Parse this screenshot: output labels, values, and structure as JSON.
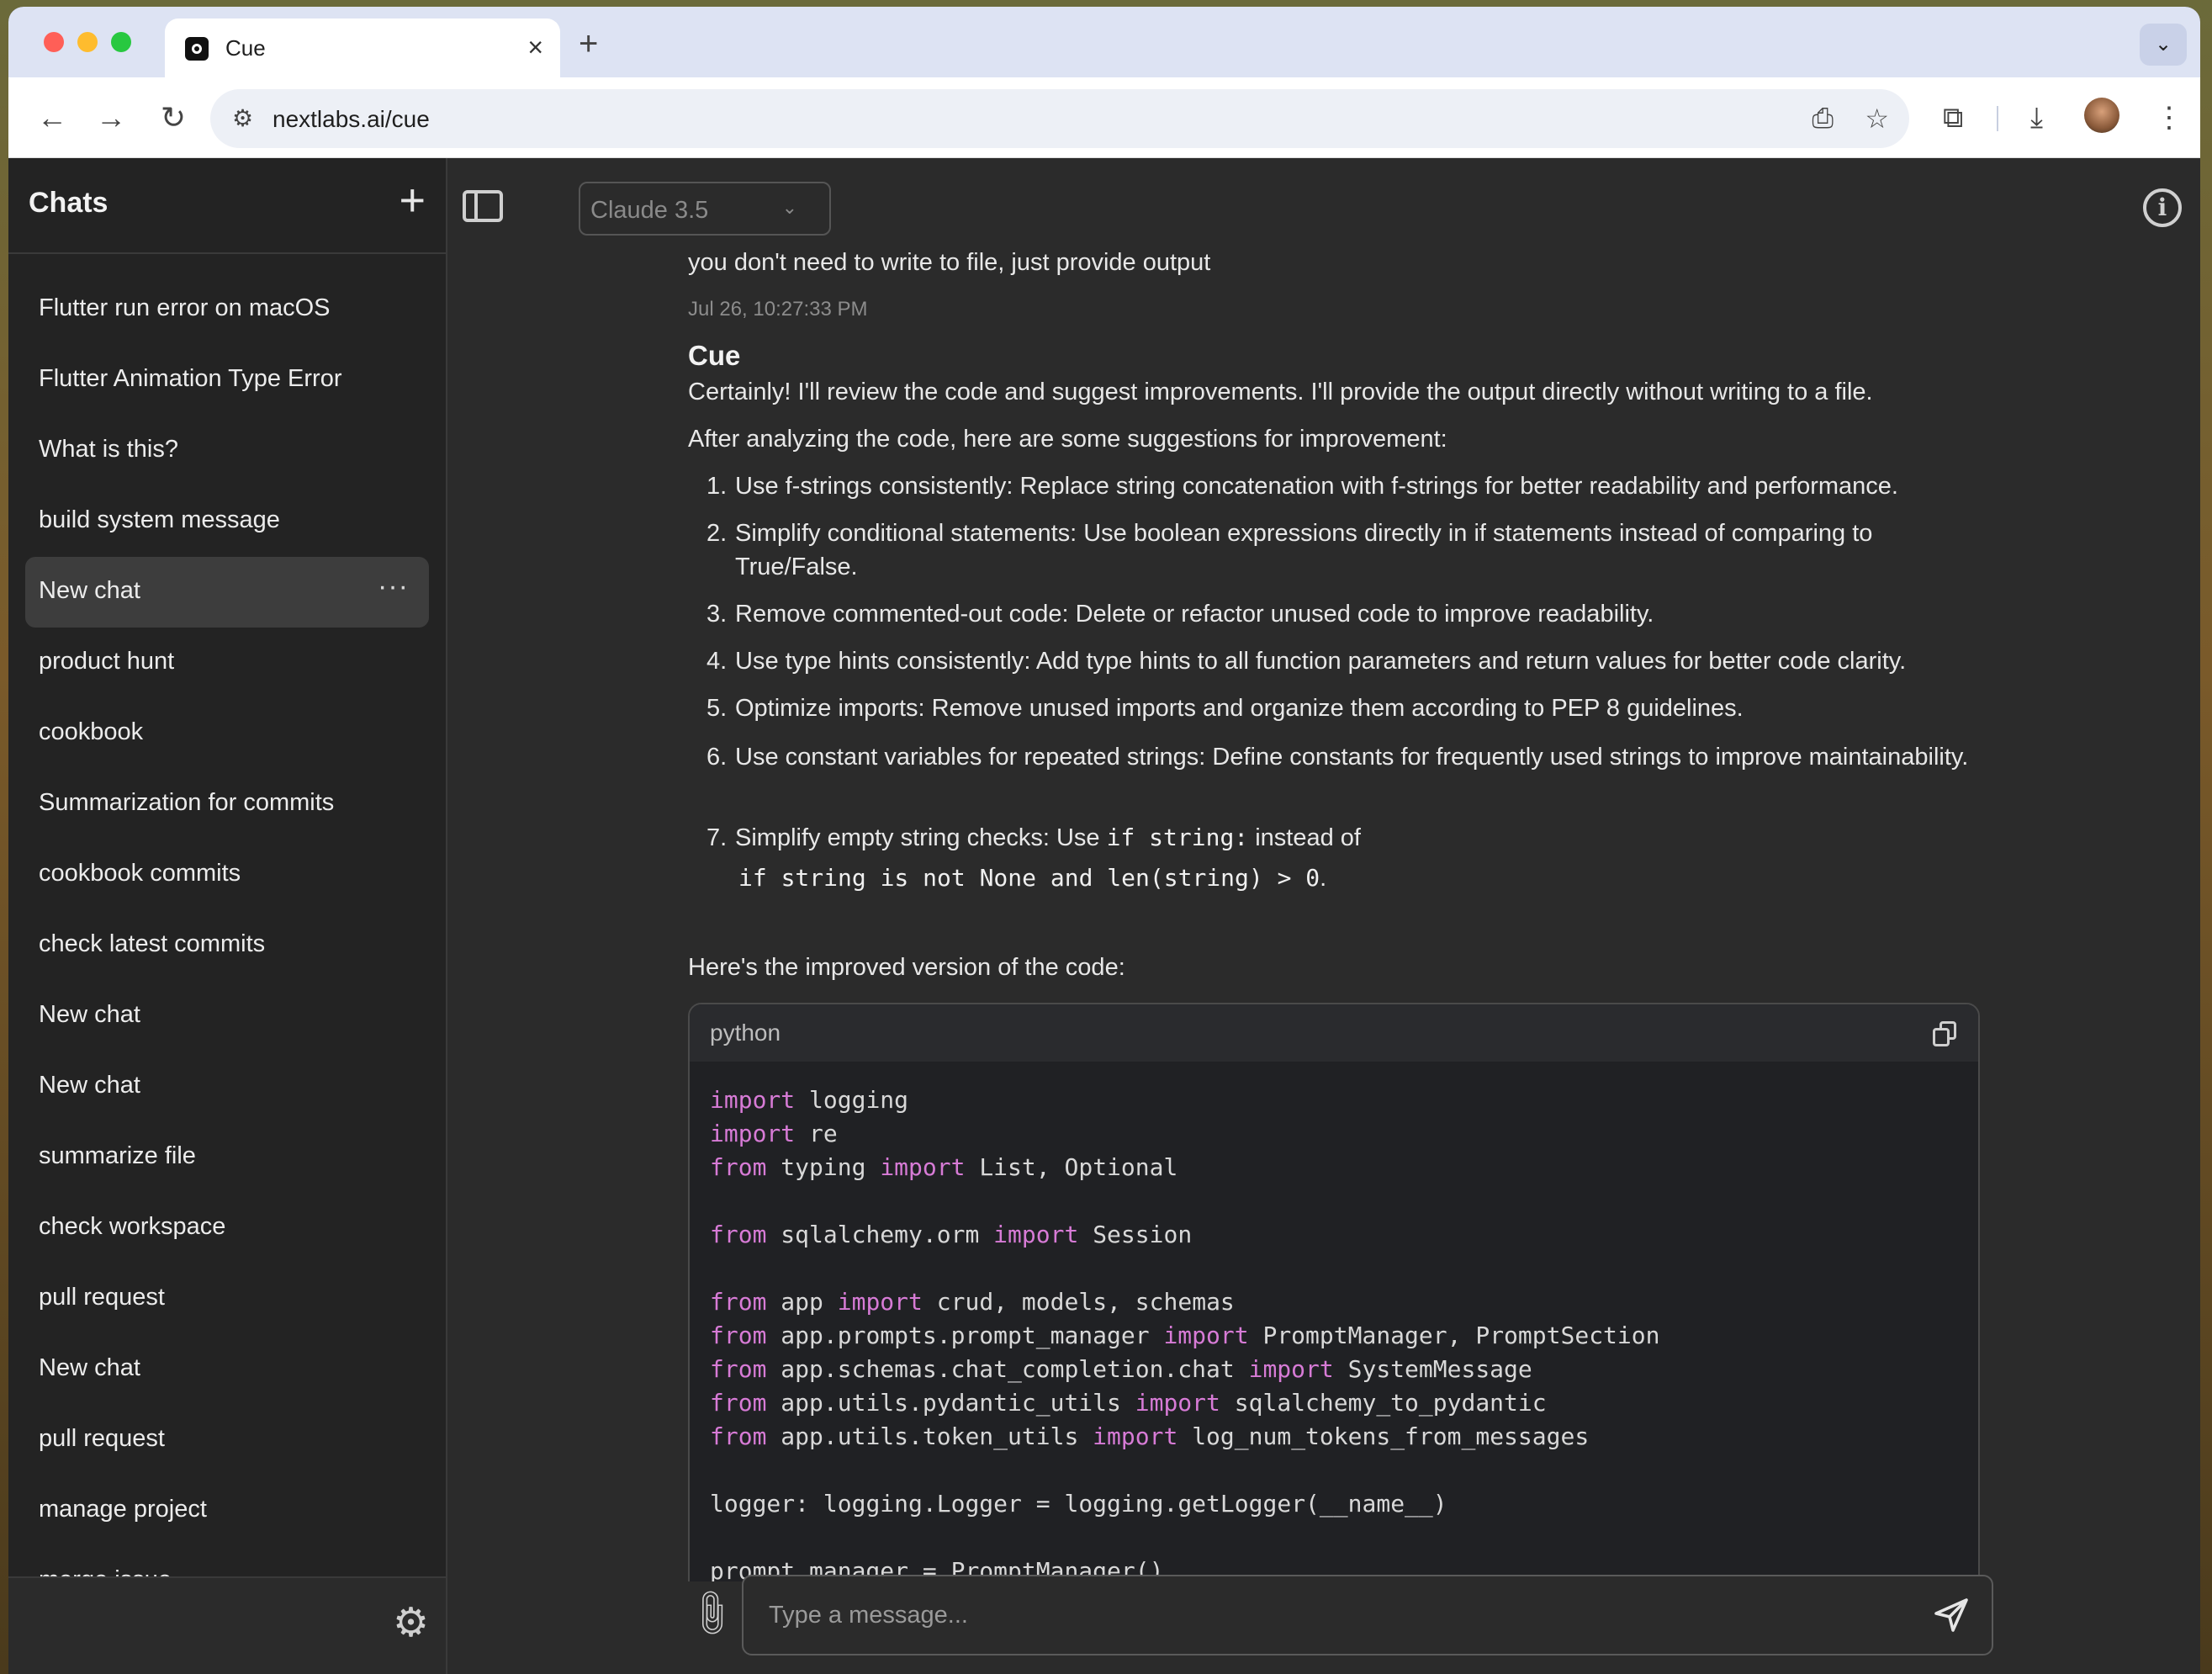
{
  "browser": {
    "tab_title": "Cue",
    "tab_close": "×",
    "new_tab": "+",
    "url": "nextlabs.ai/cue"
  },
  "sidebar": {
    "title": "Chats",
    "new_chat_icon": "+",
    "active_more": "···",
    "items": [
      {
        "label": "Flutter run error on macOS"
      },
      {
        "label": "Flutter Animation Type Error"
      },
      {
        "label": "What is this?"
      },
      {
        "label": "build system message"
      },
      {
        "label": "New chat",
        "active": true
      },
      {
        "label": "product hunt"
      },
      {
        "label": "cookbook"
      },
      {
        "label": "Summarization for commits"
      },
      {
        "label": "cookbook commits"
      },
      {
        "label": "check latest commits"
      },
      {
        "label": "New chat"
      },
      {
        "label": "New chat"
      },
      {
        "label": "summarize file"
      },
      {
        "label": "check workspace"
      },
      {
        "label": "pull request"
      },
      {
        "label": "New chat"
      },
      {
        "label": "pull request"
      },
      {
        "label": "manage project"
      },
      {
        "label": "merge issue"
      }
    ]
  },
  "header": {
    "model": "Claude 3.5"
  },
  "conversation": {
    "user_message": "you don't need to write to file, just provide output",
    "user_timestamp": "Jul 26, 10:27:33 PM",
    "assistant_name": "Cue",
    "intro": "Certainly! I'll review the code and suggest improvements. I'll provide the output directly without writing to a file.",
    "analysis_intro": "After analyzing the code, here are some suggestions for improvement:",
    "suggestions": [
      {
        "num": "1.",
        "text": "Use f-strings consistently: Replace string concatenation with f-strings for better readability and performance."
      },
      {
        "num": "2.",
        "text": "Simplify conditional statements: Use boolean expressions directly in if statements instead of comparing to True/False."
      },
      {
        "num": "3.",
        "text": "Remove commented-out code: Delete or refactor unused code to improve readability."
      },
      {
        "num": "4.",
        "text": "Use type hints consistently: Add type hints to all function parameters and return values for better code clarity."
      },
      {
        "num": "5.",
        "text": "Optimize imports: Remove unused imports and organize them according to PEP 8 guidelines."
      },
      {
        "num": "6.",
        "text": "Use constant variables for repeated strings: Define constants for frequently used strings to improve maintainability."
      }
    ],
    "suggestion7": {
      "num": "7.",
      "text_before": "Simplify empty string checks: Use ",
      "code1": "if string:",
      "text_mid": " instead of",
      "code2": "if string is not None and len(string) > 0",
      "text_end": "."
    },
    "improved_intro": "Here's the improved version of the code:",
    "code_language": "python",
    "code_lines": [
      "import logging",
      "import re",
      "from typing import List, Optional",
      "",
      "from sqlalchemy.orm import Session",
      "",
      "from app import crud, models, schemas",
      "from app.prompts.prompt_manager import PromptManager, PromptSection",
      "from app.schemas.chat_completion.chat import SystemMessage",
      "from app.utils.pydantic_utils import sqlalchemy_to_pydantic",
      "from app.utils.token_utils import log_num_tokens_from_messages",
      "",
      "logger: logging.Logger = logging.getLogger(__name__)",
      "",
      "prompt_manager = PromptManager()"
    ]
  },
  "composer": {
    "placeholder": "Type a message..."
  },
  "colors": {
    "keyword": "#d77bd6",
    "sidebar_bg": "#232323",
    "main_bg": "#2b2b2b",
    "code_bg": "#202124"
  }
}
